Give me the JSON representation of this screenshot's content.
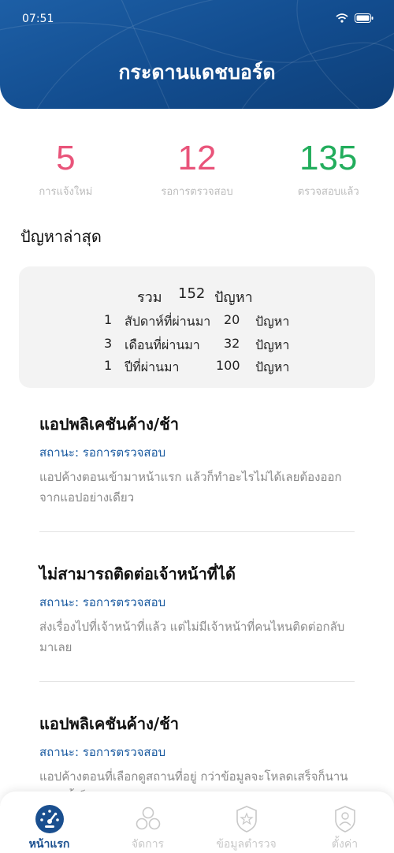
{
  "status_bar": {
    "time": "07:51"
  },
  "header": {
    "title": "กระดานแดชบอร์ด"
  },
  "stats": [
    {
      "value": "5",
      "label": "การแจ้งใหม่",
      "color": "#e9547a"
    },
    {
      "value": "12",
      "label": "รอการตรวจสอบ",
      "color": "#e9547a"
    },
    {
      "value": "135",
      "label": "ตรวจสอบแล้ว",
      "color": "#22ad5c"
    }
  ],
  "section_title": "ปัญหาล่าสุด",
  "summary": {
    "total_label": "รวม",
    "total_value": "152",
    "total_unit": "ปัญหา",
    "rows": [
      {
        "count": "1",
        "period": "สัปดาห์ที่ผ่านมา",
        "value": "20",
        "unit": "ปัญหา"
      },
      {
        "count": "3",
        "period": "เดือนที่ผ่านมา",
        "value": "32",
        "unit": "ปัญหา"
      },
      {
        "count": "1",
        "period": "ปีที่ผ่านมา",
        "value": "100",
        "unit": "ปัญหา"
      }
    ]
  },
  "issues": [
    {
      "title": "แอปพลิเคชันค้าง/ช้า",
      "status": "สถานะ: รอการตรวจสอบ",
      "description": "แอปค้างตอนเข้ามาหน้าแรก แล้วก็ทำอะไรไม่ได้เลยต้องออกจากแอปอย่างเดียว"
    },
    {
      "title": "ไม่สามารถติดต่อเจ้าหน้าที่ได้",
      "status": "สถานะ: รอการตรวจสอบ",
      "description": "ส่งเรื่องไปที่เจ้าหน้าที่แล้ว แต่ไม่มีเจ้าหน้าที่คนไหนติดต่อกลับมาเลย"
    },
    {
      "title": "แอปพลิเคชันค้าง/ช้า",
      "status": "สถานะ: รอการตรวจสอบ",
      "description": "แอปค้างตอนที่เลือกดูสถานที่อยู่ กว่าข้อมูลจะโหลดเสร็จก็นาน บางครั้งก็หลุดออกจากแอปเลย"
    }
  ],
  "tabs": [
    {
      "label": "หน้าแรก",
      "icon": "dashboard-gauge-icon",
      "active": true
    },
    {
      "label": "จัดการ",
      "icon": "circles-icon"
    },
    {
      "label": "ข้อมูลตำรวจ",
      "icon": "police-badge-icon"
    },
    {
      "label": "ตั้งค่า",
      "icon": "user-badge-icon"
    }
  ],
  "colors": {
    "primary": "#124c8e",
    "accent_pink": "#e9547a",
    "accent_green": "#22ad5c",
    "status_blue": "#1a5aa0"
  }
}
